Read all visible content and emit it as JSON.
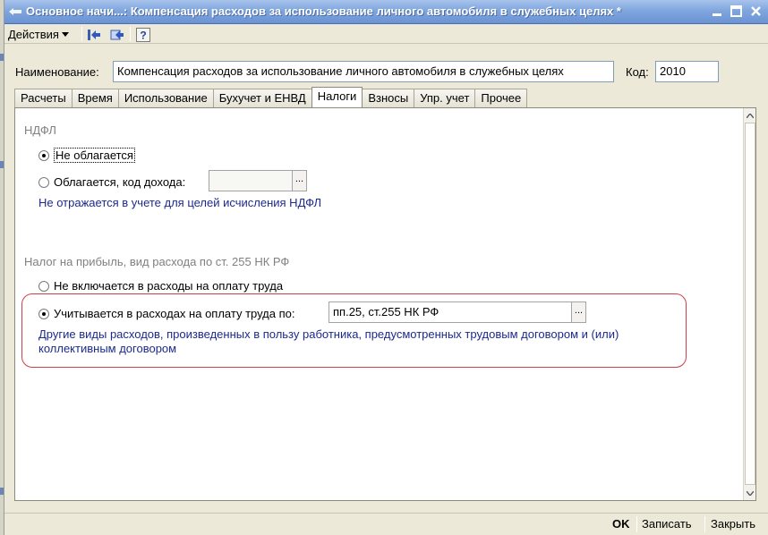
{
  "window": {
    "title": "Основное начи...: Компенсация расходов за использование личного автомобиля в служебных целях *"
  },
  "toolbar": {
    "actions_label": "Действия",
    "icons": [
      "back-arrow-icon",
      "forward-arrow-icon",
      "help-icon"
    ],
    "help_glyph": "?"
  },
  "header": {
    "name_label": "Наименование:",
    "name_value": "Компенсация расходов за использование личного автомобиля в служебных целях",
    "code_label": "Код:",
    "code_value": "2010"
  },
  "tabs": [
    {
      "label": "Расчеты",
      "active": false
    },
    {
      "label": "Время",
      "active": false
    },
    {
      "label": "Использование",
      "active": false
    },
    {
      "label": "Бухучет и ЕНВД",
      "active": false
    },
    {
      "label": "Налоги",
      "active": true
    },
    {
      "label": "Взносы",
      "active": false
    },
    {
      "label": "Упр. учет",
      "active": false
    },
    {
      "label": "Прочее",
      "active": false
    }
  ],
  "ndfl": {
    "title": "НДФЛ",
    "option_not_taxed": "Не облагается",
    "option_taxed": "Облагается, код дохода:",
    "income_code_value": "",
    "picker_button": "...",
    "selected": "not_taxed",
    "note": "Не отражается в учете для целей исчисления НДФЛ"
  },
  "profit_tax": {
    "title": "Налог на прибыль, вид расхода по ст. 255 НК РФ",
    "option_not_included": "Не включается в расходы на оплату труда",
    "option_included": "Учитывается в расходах на оплату труда по:",
    "article_value": "пп.25, ст.255 НК РФ",
    "picker_button": "...",
    "selected": "included",
    "note": "Другие виды расходов, произведенных в пользу работника, предусмотренных трудовым договором и (или) коллективным договором"
  },
  "footer": {
    "ok": "OK",
    "save": "Записать",
    "close": "Закрыть"
  },
  "colors": {
    "title_bar": "#7fa6de",
    "hint_text": "#1c2a8c",
    "highlight_border": "#cf3f49",
    "section_title": "#808080"
  }
}
